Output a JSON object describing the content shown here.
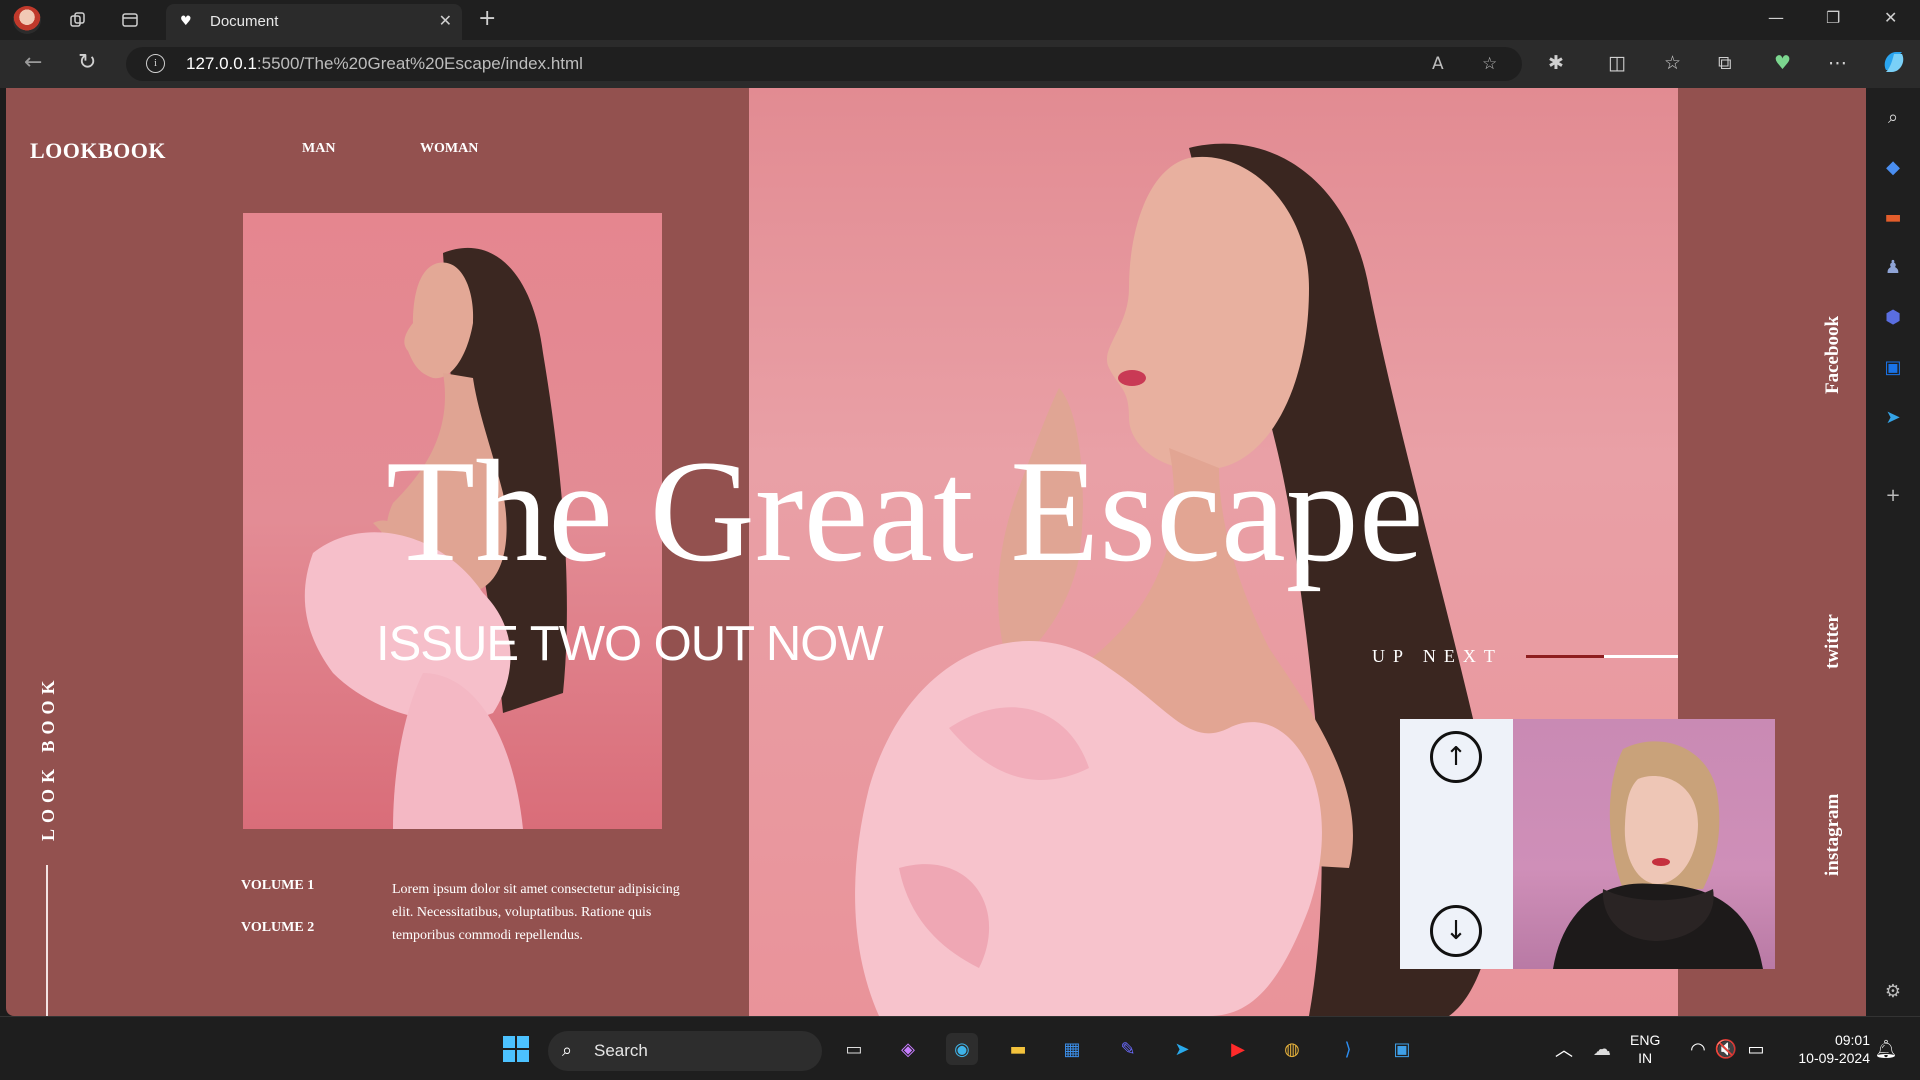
{
  "browser": {
    "tab_title": "Document",
    "url_host": "127.0.0.1",
    "url_rest": ":5500/The%20Great%20Escape/index.html"
  },
  "site": {
    "logo": "LOOKBOOK",
    "nav": [
      "MAN",
      "WOMAN"
    ],
    "hero_title": "The Great Escape",
    "hero_subtitle": "ISSUE TWO OUT NOW",
    "vertical_label": "LOOK BOOK",
    "volumes": [
      "VOLUME 1",
      "VOLUME 2"
    ],
    "lorem": "Lorem ipsum dolor sit amet consectetur adipisicing elit. Necessitatibus, voluptatibus. Ratione quis temporibus commodi repellendus.",
    "up_next": "UP NEXT",
    "social": [
      "Facebook",
      "twitter",
      "instagram"
    ]
  },
  "taskbar": {
    "search_label": "Search",
    "lang_line1": "ENG",
    "lang_line2": "IN",
    "time": "09:01",
    "date": "10-09-2024"
  },
  "colors": {
    "page_bg": "#93514f",
    "hero_pink": "#e9a0a6",
    "accent_dark_red": "#8e1e1f"
  }
}
